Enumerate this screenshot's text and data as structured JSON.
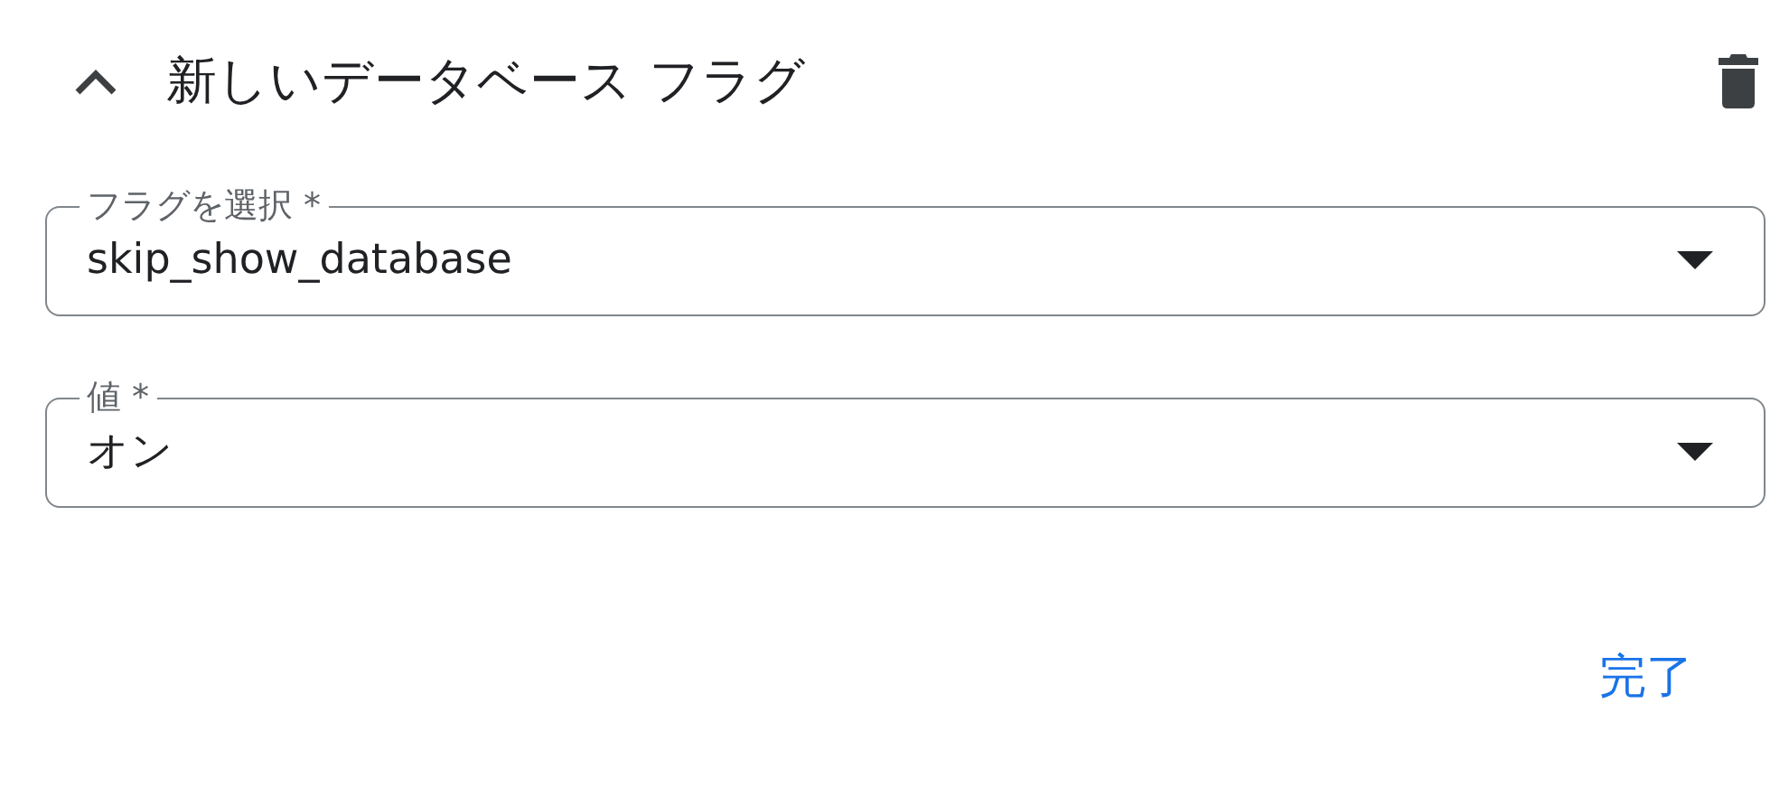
{
  "header": {
    "title": "新しいデータベース フラグ",
    "expanded": true
  },
  "fields": [
    {
      "label": "フラグを選択 *",
      "value": "skip_show_database"
    },
    {
      "label": "値 *",
      "value": "オン"
    }
  ],
  "buttons": [
    {
      "label": "完了"
    }
  ]
}
